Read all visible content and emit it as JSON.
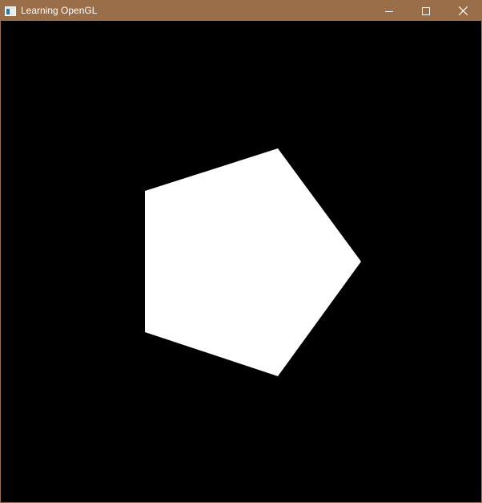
{
  "window": {
    "title": "Learning OpenGL",
    "titlebar_color": "#9a6e49",
    "controls": [
      {
        "name": "minimize",
        "icon": "minimize-icon"
      },
      {
        "name": "maximize",
        "icon": "maximize-icon"
      },
      {
        "name": "close",
        "icon": "close-icon"
      }
    ]
  },
  "scene": {
    "background_color": "#000000",
    "shape": "pentagon",
    "shape_color": "#ffffff"
  }
}
